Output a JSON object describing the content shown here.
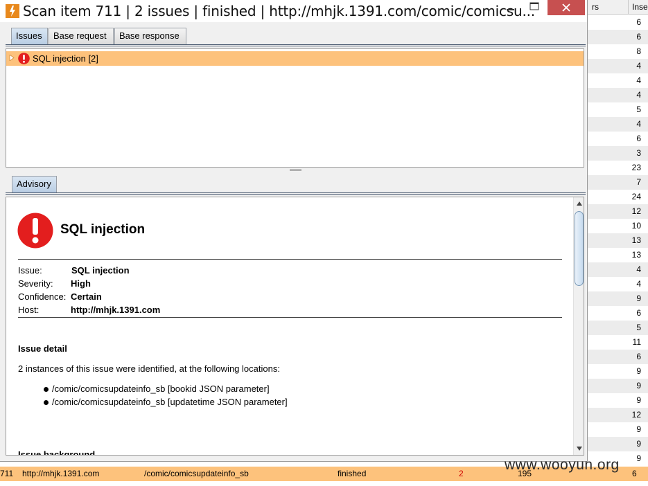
{
  "window": {
    "title": "Scan item 711 | 2 issues | finished | http://mhjk.1391.com/comic/comicsu..."
  },
  "top_tabs": [
    {
      "label": "Issues",
      "active": true
    },
    {
      "label": "Base request",
      "active": false
    },
    {
      "label": "Base response",
      "active": false
    }
  ],
  "issues_tree": {
    "items": [
      {
        "label": "SQL injection [2]",
        "severity_icon": "high-severity-icon"
      }
    ]
  },
  "advisory_tab": {
    "label": "Advisory"
  },
  "advisory": {
    "title": "SQL injection",
    "fields": [
      {
        "label": "Issue:",
        "value": "SQL injection"
      },
      {
        "label": "Severity:",
        "value": "High"
      },
      {
        "label": "Confidence:",
        "value": "Certain"
      },
      {
        "label": "Host:",
        "value": "http://mhjk.1391.com"
      }
    ],
    "issue_detail_heading": "Issue detail",
    "issue_detail_text": "2 instances of this issue were identified, at the following locations:",
    "locations": [
      "/comic/comicsupdateinfo_sb [bookid JSON parameter]",
      "/comic/comicsupdateinfo_sb [updatetime JSON parameter]"
    ],
    "issue_background_heading": "Issue background"
  },
  "background_table": {
    "headers": [
      "rs",
      "Inse"
    ],
    "values": [
      "6",
      "6",
      "8",
      "4",
      "4",
      "4",
      "5",
      "4",
      "6",
      "3",
      "23",
      "7",
      "24",
      "12",
      "10",
      "13",
      "13",
      "4",
      "4",
      "9",
      "6",
      "5",
      "11",
      "6",
      "9",
      "9",
      "9",
      "12",
      "9",
      "9",
      "9"
    ]
  },
  "background_rows": [
    {
      "id": "711",
      "host": "http://mhjk.1391.com",
      "path": "/comic/comicsupdateinfo_sb",
      "status": "finished",
      "issues": "2",
      "requests": "195",
      "insertion": "6"
    }
  ],
  "watermark": "www.wooyun.org",
  "colors": {
    "highlight_row": "#fdc27c",
    "issue_count_red": "#d00000",
    "severity_red": "#e31e1e"
  }
}
